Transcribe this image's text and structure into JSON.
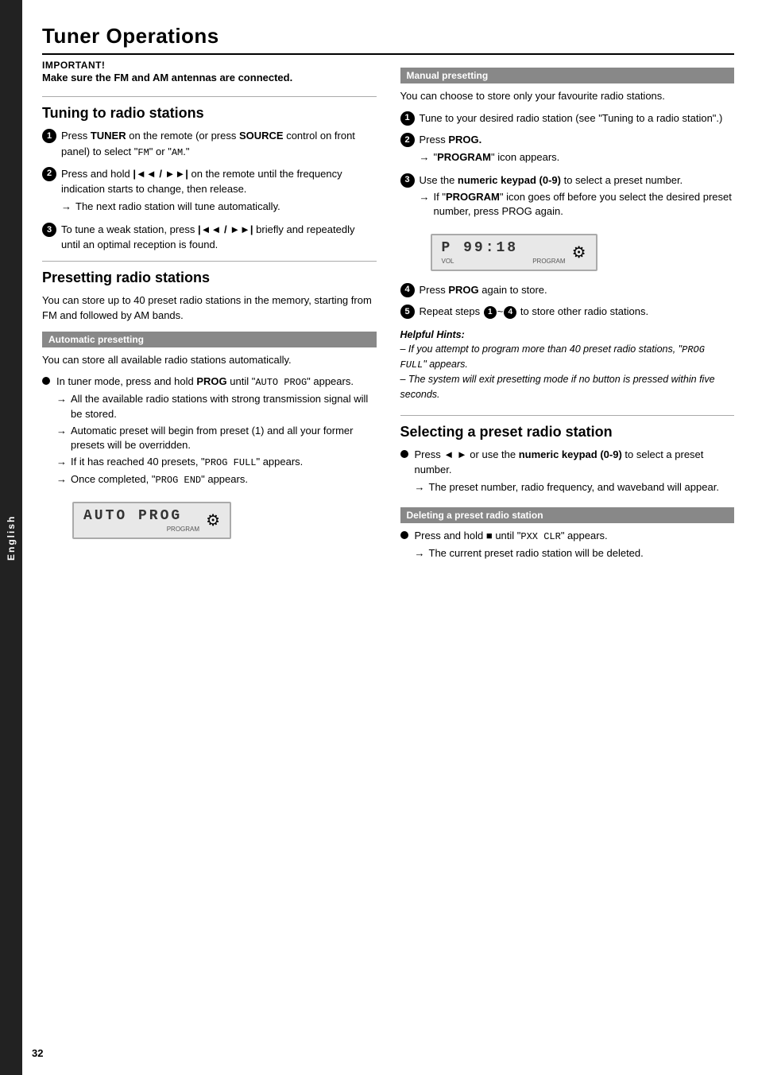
{
  "page": {
    "title": "Tuner Operations",
    "page_number": "32",
    "sidebar_label": "English"
  },
  "important": {
    "label": "IMPORTANT!",
    "text": "Make sure the FM and AM antennas are connected."
  },
  "tuning_section": {
    "title": "Tuning to radio stations",
    "steps": [
      {
        "num": "1",
        "text_before": "Press ",
        "bold1": "TUNER",
        "text_mid": " on the remote (or press ",
        "bold2": "SOURCE",
        "text_after": " control on front panel) to select “FM” or “AM.”"
      },
      {
        "num": "2",
        "text_before": "Press and hold ",
        "symbol": "|◄◄ / ►►|",
        "text_after": " on the remote until the frequency indication starts to change, then release.",
        "arrow": "The next radio station will tune automatically."
      },
      {
        "num": "3",
        "text_before": "To tune a weak station, press ",
        "symbol": "|◄◄ / ►►|",
        "text_after": " briefly and repeatedly until an optimal reception is found."
      }
    ]
  },
  "presetting_section": {
    "title": "Presetting radio stations",
    "subtitle": "You can store up to 40 preset radio stations in the memory, starting from FM and followed by AM bands.",
    "auto_header": "Automatic presetting",
    "auto_subtitle": "You can store all available radio stations automatically.",
    "auto_step": {
      "text": "In tuner mode, press and hold PROG until “AUTO PROG” appears.",
      "arrows": [
        "All the available radio stations with strong transmission signal will be stored.",
        "Automatic preset will begin from preset (1) and all your former presets will be overridden.",
        "If it has reached 40 presets, “PROG FULL” appears.",
        "Once completed, “PROG END” appears."
      ]
    },
    "display1": {
      "text": "AUTO PROG",
      "sub_left": "",
      "sub_right": "PROGRAM"
    }
  },
  "manual_section": {
    "header": "Manual presetting",
    "subtitle": "You can choose to store only your favourite radio stations.",
    "steps": [
      {
        "num": "1",
        "text": "Tune to your desired radio station (see “Tuning to a radio station”.)"
      },
      {
        "num": "2",
        "text_before": "Press ",
        "bold": "PROG.",
        "arrow": "“PROGRAM” icon appears."
      },
      {
        "num": "3",
        "text_before": "Use the ",
        "bold": "numeric keypad (0-9)",
        "text_after": " to select a preset number.",
        "arrow": "If “PROGRAM” icon goes off before you select the desired preset number, press PROG again."
      },
      {
        "num": "4",
        "text_before": "Press ",
        "bold": "PROG",
        "text_after": " again to store."
      },
      {
        "num": "5",
        "text_before": "Repeat steps ",
        "circle1": "1",
        "text_mid": "–",
        "circle2": "4",
        "text_after": " to store other radio stations."
      }
    ],
    "display2": {
      "main": "P  99:18",
      "sub_left": "VOL",
      "sub_right": "PROGRAM"
    },
    "helpful_hints": {
      "title": "Helpful Hints:",
      "lines": [
        "– If you attempt to program more than 40 preset radio stations, “PROG FULL” appears.",
        "– The system will exit presetting mode if no button is pressed within five seconds."
      ]
    }
  },
  "selecting_section": {
    "title": "Selecting a preset radio station",
    "step": {
      "text_before": "Press ◄ ► or use the ",
      "bold": "numeric keypad (0-9)",
      "text_after": " to select a preset number.",
      "arrow": "The preset number, radio frequency, and waveband will appear."
    }
  },
  "deleting_section": {
    "header": "Deleting a preset radio station",
    "step": {
      "text_before": "Press and hold ",
      "symbol": "■",
      "text_mid": " until “PXX CLR” appears.",
      "arrow": "The current preset radio station will be deleted."
    }
  }
}
